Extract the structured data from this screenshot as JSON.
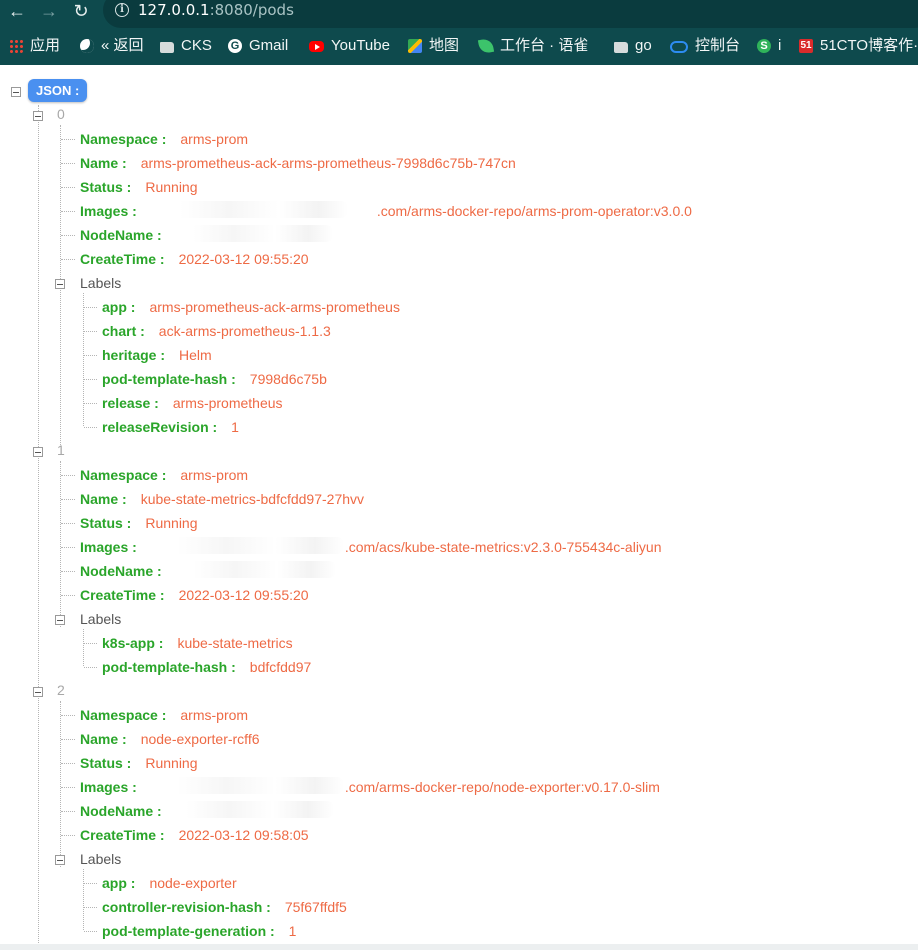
{
  "browser": {
    "url_host": "127.0.0.1",
    "url_path": ":8080/pods",
    "bookmarks": [
      {
        "label": "应用",
        "icon": "apps-grid-icon"
      },
      {
        "label": "« 返回",
        "icon": "globe-icon"
      },
      {
        "label": "CKS",
        "icon": "folder-icon"
      },
      {
        "label": "Gmail",
        "icon": "google-icon"
      },
      {
        "label": "YouTube",
        "icon": "youtube-icon"
      },
      {
        "label": "地图",
        "icon": "maps-icon"
      },
      {
        "label": "工作台 · 语雀",
        "icon": "yuque-icon"
      },
      {
        "label": "go",
        "icon": "folder-icon"
      },
      {
        "label": "控制台",
        "icon": "cloud-icon"
      },
      {
        "label": "i",
        "icon": "s-icon"
      },
      {
        "label": "51CTO博客作·",
        "icon": "51cto-icon"
      }
    ]
  },
  "tree": {
    "root_label": "JSON :",
    "pods": [
      {
        "index": "0",
        "fields": [
          {
            "key": "Namespace :",
            "value": "arms-prom"
          },
          {
            "key": "Name :",
            "value": "arms-prometheus-ack-arms-prometheus-7998d6c75b-747cn"
          },
          {
            "key": "Status :",
            "value": "Running"
          },
          {
            "key": "Images :",
            "value": ".com/arms-docker-repo/arms-prom-operator:v3.0.0"
          },
          {
            "key": "NodeName :",
            "value": ""
          },
          {
            "key": "CreateTime :",
            "value": "2022-03-12 09:55:20"
          }
        ],
        "labels_title": "Labels",
        "labels": [
          {
            "key": "app :",
            "value": "arms-prometheus-ack-arms-prometheus"
          },
          {
            "key": "chart :",
            "value": "ack-arms-prometheus-1.1.3"
          },
          {
            "key": "heritage :",
            "value": "Helm"
          },
          {
            "key": "pod-template-hash :",
            "value": "7998d6c75b"
          },
          {
            "key": "release :",
            "value": "arms-prometheus"
          },
          {
            "key": "releaseRevision :",
            "value": "1"
          }
        ]
      },
      {
        "index": "1",
        "fields": [
          {
            "key": "Namespace :",
            "value": "arms-prom"
          },
          {
            "key": "Name :",
            "value": "kube-state-metrics-bdfcfdd97-27hvv"
          },
          {
            "key": "Status :",
            "value": "Running"
          },
          {
            "key": "Images :",
            "value": ".com/acs/kube-state-metrics:v2.3.0-755434c-aliyun"
          },
          {
            "key": "NodeName :",
            "value": ""
          },
          {
            "key": "CreateTime :",
            "value": "2022-03-12 09:55:20"
          }
        ],
        "labels_title": "Labels",
        "labels": [
          {
            "key": "k8s-app :",
            "value": "kube-state-metrics"
          },
          {
            "key": "pod-template-hash :",
            "value": "bdfcfdd97"
          }
        ]
      },
      {
        "index": "2",
        "fields": [
          {
            "key": "Namespace :",
            "value": "arms-prom"
          },
          {
            "key": "Name :",
            "value": "node-exporter-rcff6"
          },
          {
            "key": "Status :",
            "value": "Running"
          },
          {
            "key": "Images :",
            "value": ".com/arms-docker-repo/node-exporter:v0.17.0-slim"
          },
          {
            "key": "NodeName :",
            "value": ""
          },
          {
            "key": "CreateTime :",
            "value": "2022-03-12 09:58:05"
          }
        ],
        "labels_title": "Labels",
        "labels": [
          {
            "key": "app :",
            "value": "node-exporter"
          },
          {
            "key": "controller-revision-hash :",
            "value": "75f67ffdf5"
          },
          {
            "key": "pod-template-generation :",
            "value": "1"
          }
        ]
      }
    ]
  },
  "colors": {
    "chrome_bg": "#0e4a4d",
    "key_green": "#2aa52a",
    "value_orange": "#ee6a45",
    "root_badge_blue": "#4a90f0"
  }
}
